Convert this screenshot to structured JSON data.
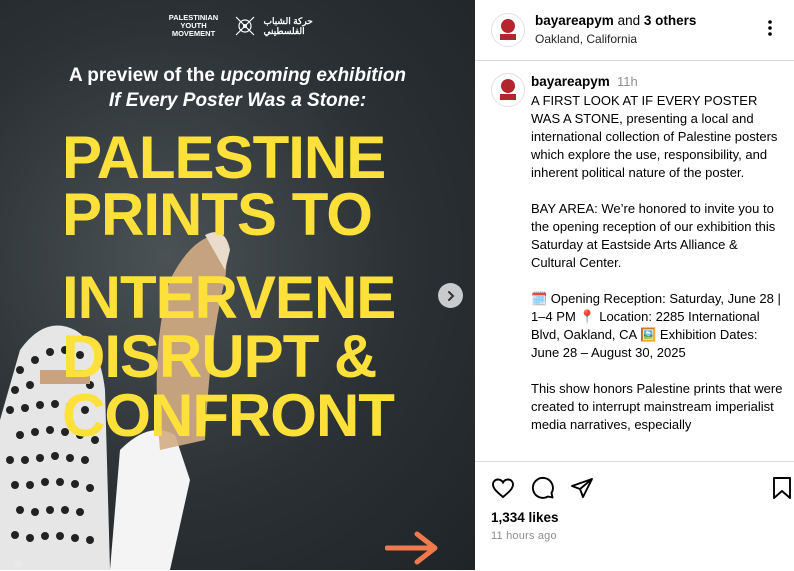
{
  "post": {
    "logo_en": "PALESTINIAN YOUTH MOVEMENT",
    "logo_ar": "حركة الشباب الفلسطيني",
    "subtitle_line1_a": "A preview of the ",
    "subtitle_line1_b": "upcoming exhibition",
    "subtitle_line2": "If Every Poster Was a Stone:",
    "headline": [
      "PALESTINE",
      "PRINTS TO",
      "INTERVENE",
      "DISRUPT &",
      "CONFRONT"
    ],
    "colors": {
      "headline": "#fde03a",
      "arrow": "#f07a4e",
      "background": "#2b3236"
    }
  },
  "header": {
    "username": "bayareapym",
    "and_text": " and ",
    "others": "3 others",
    "location": "Oakland, California"
  },
  "caption": {
    "username": "bayareapym",
    "time": "11h",
    "paragraphs": [
      "A FIRST LOOK AT IF EVERY POSTER WAS A STONE, presenting a local and international collection of Palestine posters which explore the use, responsibility, and inherent political nature of the poster.",
      "BAY AREA: We’re honored to invite you to the opening reception of our exhibition this Saturday at Eastside Arts Alliance & Cultural Center.",
      "🗓️ Opening Reception: Saturday, June 28 | 1–4 PM 📍 Location: 2285 International Blvd, Oakland, CA 🖼️ Exhibition Dates: June 28 – August 30, 2025",
      "This show honors Palestine prints that were created to interrupt mainstream imperialist media narratives, especially"
    ]
  },
  "actions": {
    "icons": [
      "heart-icon",
      "comment-icon",
      "share-icon",
      "bookmark-icon"
    ],
    "likes": "1,334 likes",
    "time_ago": "11 hours ago"
  }
}
